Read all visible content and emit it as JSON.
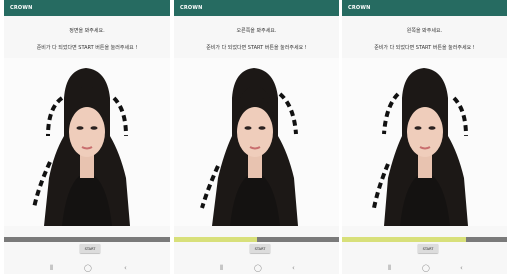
{
  "app": {
    "title": "CROWN"
  },
  "panels": [
    {
      "guide_line1": "정면을 봐주세요.",
      "guide_line2": "준비가 다 되었다면 START 버튼을 눌러주세요 !",
      "start_label": "START",
      "progress": 0.0
    },
    {
      "guide_line1": "오른쪽을 봐주세요.",
      "guide_line2": "준비가 다 되었다면 START 버튼을 눌러주세요 !",
      "start_label": "START",
      "progress": 0.5
    },
    {
      "guide_line1": "왼쪽을 봐주세요.",
      "guide_line2": "준비가 다 되었다면 START 버튼을 눌러주세요 !",
      "start_label": "START",
      "progress": 0.75
    }
  ],
  "navbar": {
    "icons": [
      "recent-apps-icon",
      "home-icon",
      "back-icon"
    ]
  },
  "colors": {
    "appbar": "#266b61",
    "progress_track": "#7a7a7a",
    "progress_fill": "#d8e07a"
  }
}
